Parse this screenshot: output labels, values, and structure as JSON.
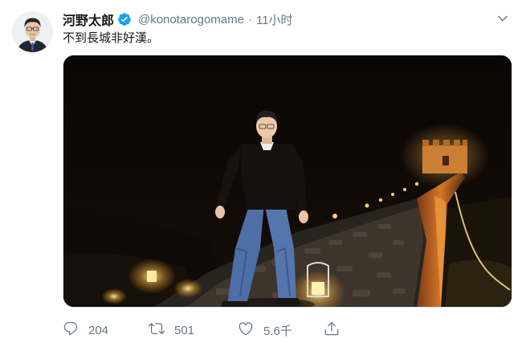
{
  "tweet": {
    "author": {
      "display_name": "河野太郎",
      "handle": "@konotarogomame",
      "verified": true
    },
    "separator": "·",
    "time_ago": "11小时",
    "text": "不到長城非好漢。",
    "stats": {
      "replies": "204",
      "retweets": "501",
      "likes": "5.6千"
    }
  },
  "colors": {
    "text_primary": "#14171a",
    "text_secondary": "#657786",
    "verified_blue": "#1da1f2",
    "border": "#e1e8ed"
  },
  "icons": {
    "verified": "verified-badge-icon",
    "caret": "chevron-down-icon",
    "reply": "reply-icon",
    "retweet": "retweet-icon",
    "like": "heart-icon",
    "share": "share-icon"
  }
}
